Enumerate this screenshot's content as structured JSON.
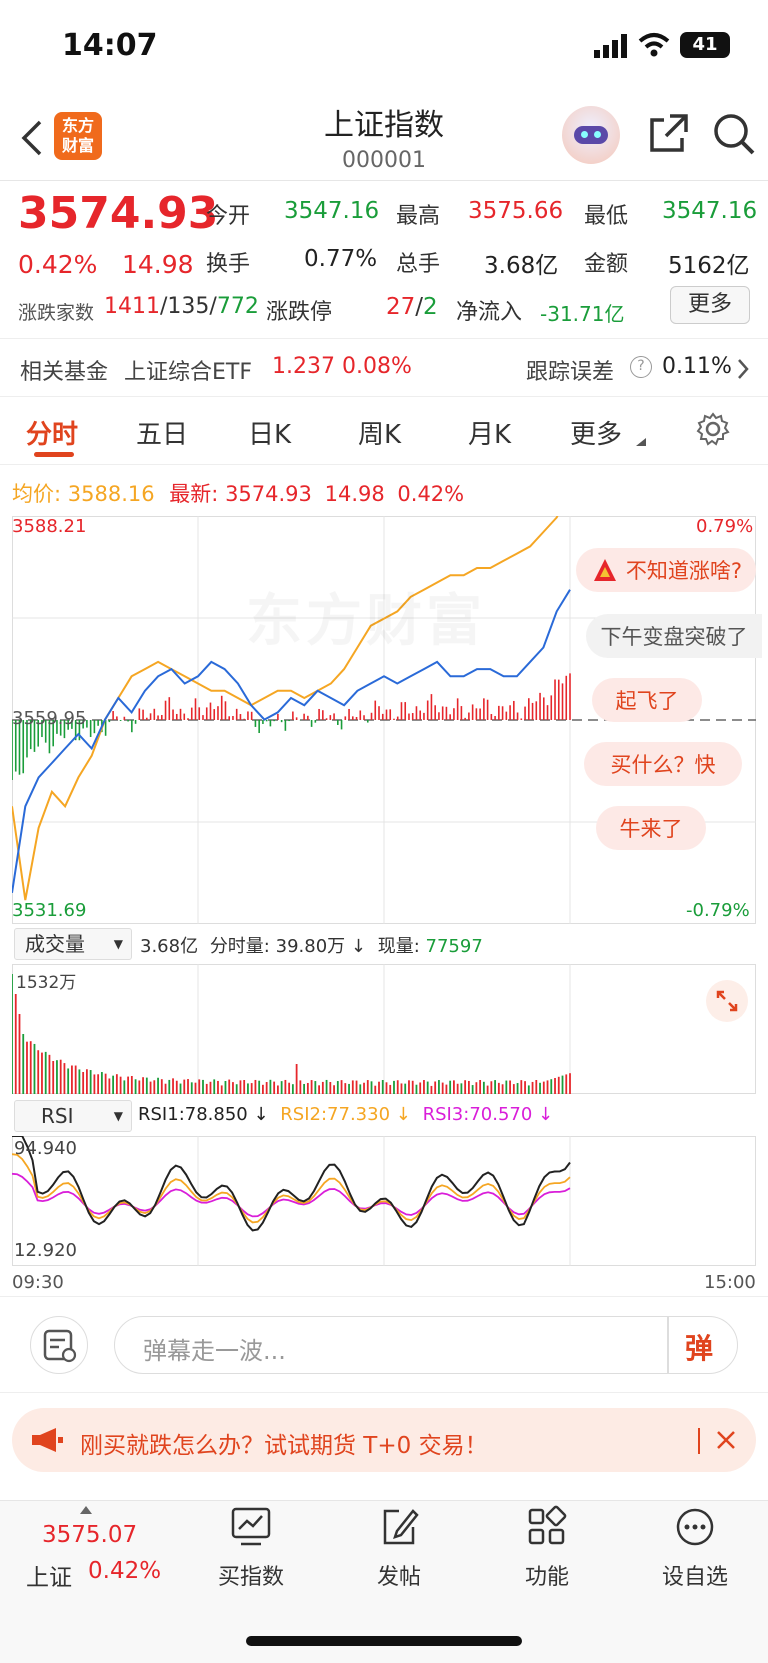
{
  "status": {
    "time": "14:07",
    "battery": "41"
  },
  "header": {
    "title": "上证指数",
    "code": "000001",
    "logo_line1": "东方",
    "logo_line2": "财富"
  },
  "quote": {
    "price": "3574.93",
    "pct": "0.42%",
    "change": "14.98",
    "open_label": "今开",
    "open": "3547.16",
    "high_label": "最高",
    "high": "3575.66",
    "low_label": "最低",
    "low": "3547.16",
    "turnover_label": "换手",
    "turnover": "0.77%",
    "vol_label": "总手",
    "vol": "3.68亿",
    "amount_label": "金额",
    "amount": "5162亿",
    "breadth_label": "涨跌家数",
    "up": "1411",
    "flat": "135",
    "down": "772",
    "limit_label": "涨跌停",
    "limit_up": "27",
    "limit_down": "2",
    "flow_label": "净流入",
    "flow": "-31.71亿",
    "more_btn": "更多"
  },
  "fund": {
    "label": "相关基金",
    "name": "上证综合ETF",
    "price": "1.237",
    "pct": "0.08%",
    "track_label": "跟踪误差",
    "track": "0.11%"
  },
  "tabs": [
    "分时",
    "五日",
    "日K",
    "周K",
    "月K",
    "更多"
  ],
  "chart_header": {
    "avg_label": "均价:",
    "avg": "3588.16",
    "latest_label": "最新:",
    "latest": "3574.93",
    "chg": "14.98",
    "pct": "0.42%"
  },
  "chart_labels": {
    "y_top": "3588.21",
    "y_mid": "3559.95",
    "y_bot": "3531.69",
    "pct_top": "0.79%",
    "pct_bot": "-0.79%",
    "watermark": "东方财富"
  },
  "danmaku": [
    "不知道涨啥?",
    "下午变盘突破了",
    "起飞了",
    "买什么？快",
    "牛来了"
  ],
  "volume_panel": {
    "selector": "成交量",
    "total": "3.68亿",
    "tick_label": "分时量:",
    "tick": "39.80万",
    "arrow": "↓",
    "now_label": "现量:",
    "now": "77597",
    "max": "1532万"
  },
  "rsi_panel": {
    "selector": "RSI",
    "rsi1": "RSI1:78.850 ↓",
    "rsi2": "RSI2:77.330 ↓",
    "rsi3": "RSI3:70.570 ↓",
    "top": "94.940",
    "bot": "12.920"
  },
  "time_axis": {
    "start": "09:30",
    "end": "15:00"
  },
  "comment": {
    "placeholder": "弹幕走一波...",
    "send": "弹"
  },
  "ad": {
    "text": "刚买就跌怎么办？试试期货 T+0 交易！"
  },
  "bottom_nav": {
    "ticker_price": "3575.07",
    "ticker_name": "上证",
    "ticker_pct": "0.42%",
    "items": [
      "买指数",
      "发帖",
      "功能",
      "设自选"
    ]
  },
  "chart_data": {
    "type": "line",
    "title": "上证指数 分时",
    "x_range": [
      "09:30",
      "15:00"
    ],
    "ylim": [
      3531.69,
      3588.21
    ],
    "series": [
      {
        "name": "最新",
        "color": "#2a6ad8",
        "values": [
          3536,
          3548,
          3552,
          3554,
          3556,
          3558,
          3556,
          3560,
          3563,
          3561,
          3564,
          3566,
          3567,
          3565,
          3566,
          3568,
          3567,
          3565,
          3562,
          3560,
          3561,
          3563,
          3562,
          3564,
          3563,
          3562,
          3564,
          3565,
          3566,
          3565,
          3566,
          3567,
          3568,
          3566,
          3566,
          3567,
          3567,
          3566,
          3566,
          3568,
          3570,
          3575,
          3578
        ]
      },
      {
        "name": "均价",
        "color": "#f5a623",
        "values": [
          3548,
          3535,
          3545,
          3550,
          3548,
          3552,
          3555,
          3560,
          3563,
          3566,
          3567,
          3568,
          3567,
          3566,
          3565,
          3564,
          3564,
          3563,
          3562,
          3563,
          3564,
          3564,
          3563,
          3564,
          3565,
          3567,
          3570,
          3573,
          3574,
          3575,
          3577,
          3578,
          3579,
          3580,
          3580,
          3581,
          3581,
          3582,
          3583,
          3584,
          3586,
          3588,
          3592
        ]
      }
    ],
    "volume_color_up": "#e6262b",
    "volume_color_down": "#1a9d3a"
  }
}
